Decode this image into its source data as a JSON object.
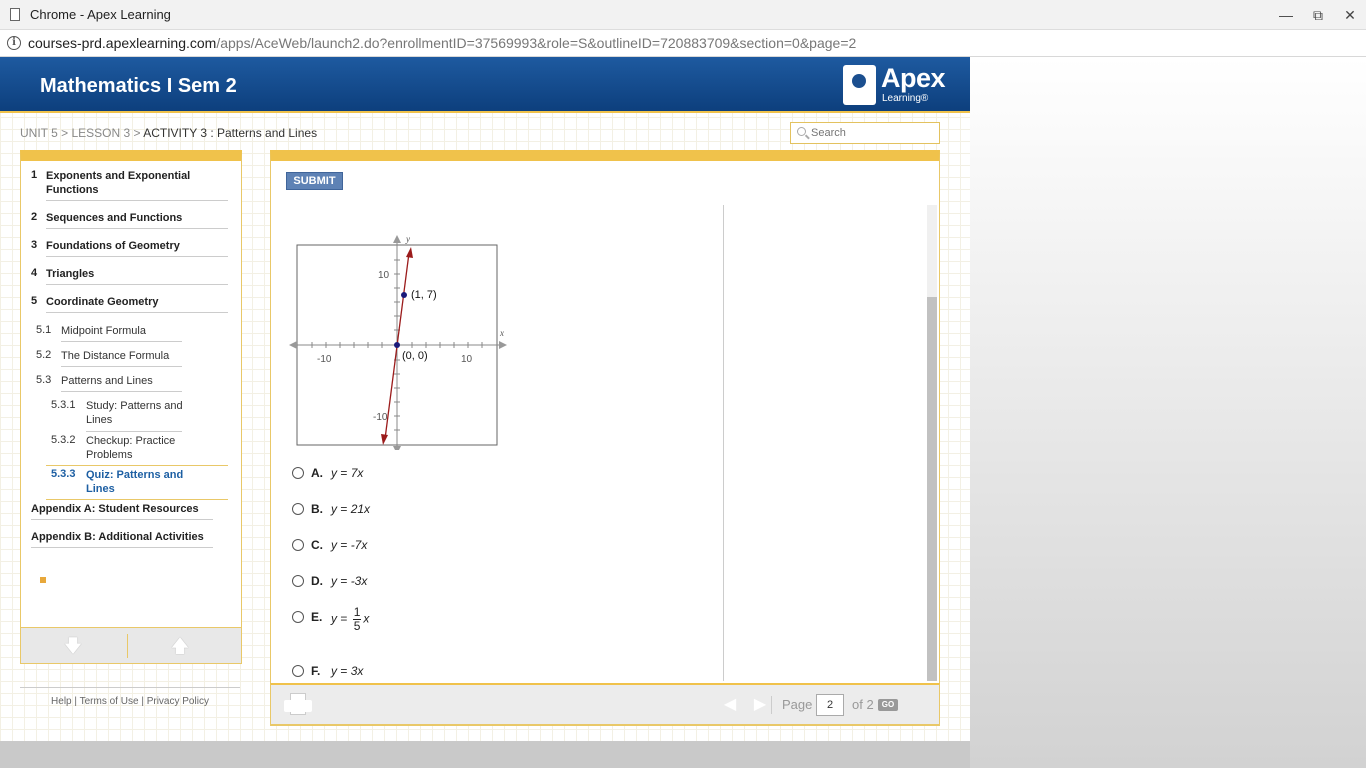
{
  "window": {
    "title": "Chrome - Apex Learning",
    "minimize_icon": "minimize-icon",
    "restore_icon": "restore-icon",
    "close_icon": "close-icon"
  },
  "address": {
    "domain": "courses-prd.apexlearning.com",
    "path": "/apps/AceWeb/launch2.do?enrollmentID=37569993&role=S&outlineID=720883709&section=0&page=2"
  },
  "header": {
    "course_title": "Mathematics I Sem 2",
    "logo_name": "Apex",
    "logo_sub": "Learning®",
    "bar_color": "#0d3f7d",
    "accent_color": "#f0c24b"
  },
  "breadcrumb": {
    "unit": "UNIT 5",
    "sep1": " > ",
    "lesson": "LESSON 3",
    "sep2": " > ",
    "activity": "ACTIVITY 3 : Patterns and Lines"
  },
  "search": {
    "placeholder": "Search"
  },
  "sidebar": {
    "units": [
      {
        "num": "1",
        "label": "Exponents and Exponential Functions"
      },
      {
        "num": "2",
        "label": "Sequences and Functions"
      },
      {
        "num": "3",
        "label": "Foundations of Geometry"
      },
      {
        "num": "4",
        "label": "Triangles"
      },
      {
        "num": "5",
        "label": "Coordinate Geometry"
      }
    ],
    "lessons": [
      {
        "num": "5.1",
        "label": "Midpoint Formula"
      },
      {
        "num": "5.2",
        "label": "The Distance Formula"
      },
      {
        "num": "5.3",
        "label": "Patterns and Lines"
      }
    ],
    "activities": [
      {
        "num": "5.3.1",
        "label": "Study: Patterns and Lines"
      },
      {
        "num": "5.3.2",
        "label": "Checkup: Practice Problems"
      },
      {
        "num": "5.3.3",
        "label": "Quiz: Patterns and Lines"
      }
    ],
    "appendices": [
      {
        "label": "Appendix A: Student Resources"
      },
      {
        "label": "Appendix B: Additional Activities"
      }
    ],
    "down_icon": "arrow-down-icon",
    "up_icon": "arrow-up-icon"
  },
  "footer_links": {
    "help": "Help",
    "sep": "|",
    "terms": "Terms of Use",
    "privacy": "Privacy Policy"
  },
  "quiz": {
    "submit_label": "SUBMIT",
    "graph": {
      "x_axis_label": "x",
      "y_axis_label": "y",
      "tick_neg10": "-10",
      "tick_10": "10",
      "point1_label": "(1, 7)",
      "point2_label": "(0, 0)",
      "line_color": "#9b1b1b",
      "point_color": "#1a1a7a"
    },
    "choices": [
      {
        "letter": "A.",
        "lhs": "y",
        "eq": " = ",
        "rhs": "7x"
      },
      {
        "letter": "B.",
        "lhs": "y",
        "eq": " = ",
        "rhs": "21x"
      },
      {
        "letter": "C.",
        "lhs": "y",
        "eq": " = ",
        "rhs": "-7x"
      },
      {
        "letter": "D.",
        "lhs": "y",
        "eq": " = ",
        "rhs": "-3x"
      },
      {
        "letter": "E.",
        "lhs": "y",
        "eq": " = ",
        "numerator": "1",
        "denominator": "5",
        "var": "x"
      },
      {
        "letter": "F.",
        "lhs": "y",
        "eq": " = ",
        "rhs": "3x"
      }
    ]
  },
  "pager": {
    "page_label": "Page",
    "page_value": "2",
    "of_label": "of 2",
    "go_label": "GO",
    "prev_icon": "prev-arrow-icon",
    "next_icon": "next-arrow-icon",
    "print_icon": "print-icon"
  }
}
